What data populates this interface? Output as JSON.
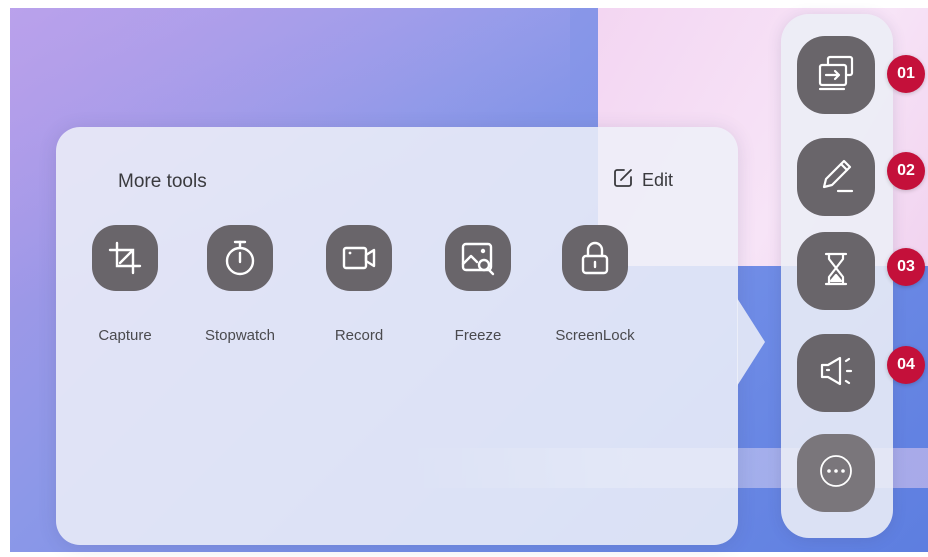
{
  "panel": {
    "title": "More tools",
    "edit_label": "Edit",
    "tools": [
      {
        "label": "Capture",
        "icon": "crop-icon"
      },
      {
        "label": "Stopwatch",
        "icon": "stopwatch-icon"
      },
      {
        "label": "Record",
        "icon": "video-camera-icon"
      },
      {
        "label": "Freeze",
        "icon": "image-search-icon"
      },
      {
        "label": "ScreenLock",
        "icon": "lock-icon"
      }
    ]
  },
  "dock": {
    "items": [
      {
        "icon": "screen-share-icon",
        "badge": "01"
      },
      {
        "icon": "pencil-icon",
        "badge": "02"
      },
      {
        "icon": "hourglass-icon",
        "badge": "03"
      },
      {
        "icon": "announcement-icon",
        "badge": "04"
      },
      {
        "icon": "more-icon"
      }
    ]
  },
  "colors": {
    "tool_button": "#69656a",
    "badge": "#c4103a",
    "panel": "#eef0f8"
  }
}
